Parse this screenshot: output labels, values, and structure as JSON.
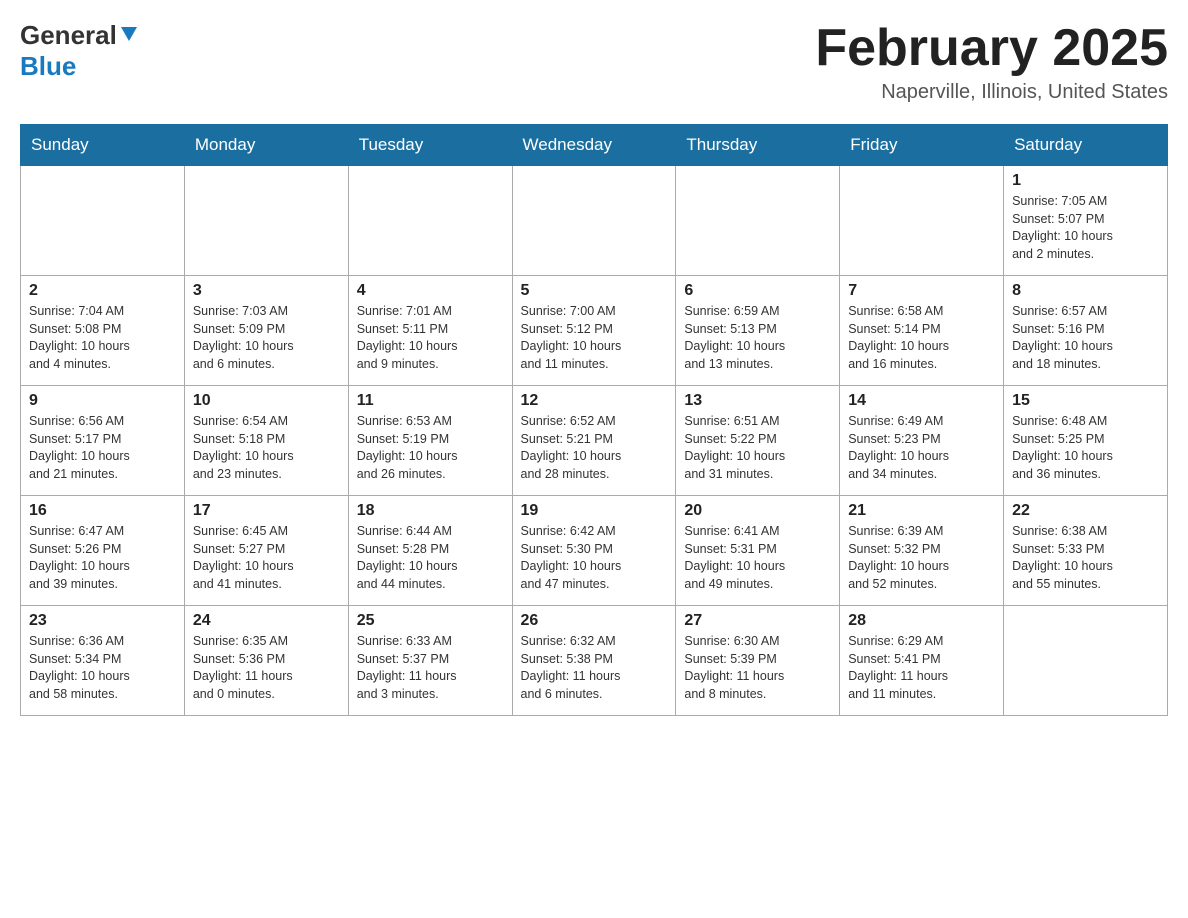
{
  "header": {
    "logo_general": "General",
    "logo_blue": "Blue",
    "month_title": "February 2025",
    "location": "Naperville, Illinois, United States"
  },
  "days_of_week": [
    "Sunday",
    "Monday",
    "Tuesday",
    "Wednesday",
    "Thursday",
    "Friday",
    "Saturday"
  ],
  "weeks": [
    [
      {
        "day": "",
        "info": ""
      },
      {
        "day": "",
        "info": ""
      },
      {
        "day": "",
        "info": ""
      },
      {
        "day": "",
        "info": ""
      },
      {
        "day": "",
        "info": ""
      },
      {
        "day": "",
        "info": ""
      },
      {
        "day": "1",
        "info": "Sunrise: 7:05 AM\nSunset: 5:07 PM\nDaylight: 10 hours\nand 2 minutes."
      }
    ],
    [
      {
        "day": "2",
        "info": "Sunrise: 7:04 AM\nSunset: 5:08 PM\nDaylight: 10 hours\nand 4 minutes."
      },
      {
        "day": "3",
        "info": "Sunrise: 7:03 AM\nSunset: 5:09 PM\nDaylight: 10 hours\nand 6 minutes."
      },
      {
        "day": "4",
        "info": "Sunrise: 7:01 AM\nSunset: 5:11 PM\nDaylight: 10 hours\nand 9 minutes."
      },
      {
        "day": "5",
        "info": "Sunrise: 7:00 AM\nSunset: 5:12 PM\nDaylight: 10 hours\nand 11 minutes."
      },
      {
        "day": "6",
        "info": "Sunrise: 6:59 AM\nSunset: 5:13 PM\nDaylight: 10 hours\nand 13 minutes."
      },
      {
        "day": "7",
        "info": "Sunrise: 6:58 AM\nSunset: 5:14 PM\nDaylight: 10 hours\nand 16 minutes."
      },
      {
        "day": "8",
        "info": "Sunrise: 6:57 AM\nSunset: 5:16 PM\nDaylight: 10 hours\nand 18 minutes."
      }
    ],
    [
      {
        "day": "9",
        "info": "Sunrise: 6:56 AM\nSunset: 5:17 PM\nDaylight: 10 hours\nand 21 minutes."
      },
      {
        "day": "10",
        "info": "Sunrise: 6:54 AM\nSunset: 5:18 PM\nDaylight: 10 hours\nand 23 minutes."
      },
      {
        "day": "11",
        "info": "Sunrise: 6:53 AM\nSunset: 5:19 PM\nDaylight: 10 hours\nand 26 minutes."
      },
      {
        "day": "12",
        "info": "Sunrise: 6:52 AM\nSunset: 5:21 PM\nDaylight: 10 hours\nand 28 minutes."
      },
      {
        "day": "13",
        "info": "Sunrise: 6:51 AM\nSunset: 5:22 PM\nDaylight: 10 hours\nand 31 minutes."
      },
      {
        "day": "14",
        "info": "Sunrise: 6:49 AM\nSunset: 5:23 PM\nDaylight: 10 hours\nand 34 minutes."
      },
      {
        "day": "15",
        "info": "Sunrise: 6:48 AM\nSunset: 5:25 PM\nDaylight: 10 hours\nand 36 minutes."
      }
    ],
    [
      {
        "day": "16",
        "info": "Sunrise: 6:47 AM\nSunset: 5:26 PM\nDaylight: 10 hours\nand 39 minutes."
      },
      {
        "day": "17",
        "info": "Sunrise: 6:45 AM\nSunset: 5:27 PM\nDaylight: 10 hours\nand 41 minutes."
      },
      {
        "day": "18",
        "info": "Sunrise: 6:44 AM\nSunset: 5:28 PM\nDaylight: 10 hours\nand 44 minutes."
      },
      {
        "day": "19",
        "info": "Sunrise: 6:42 AM\nSunset: 5:30 PM\nDaylight: 10 hours\nand 47 minutes."
      },
      {
        "day": "20",
        "info": "Sunrise: 6:41 AM\nSunset: 5:31 PM\nDaylight: 10 hours\nand 49 minutes."
      },
      {
        "day": "21",
        "info": "Sunrise: 6:39 AM\nSunset: 5:32 PM\nDaylight: 10 hours\nand 52 minutes."
      },
      {
        "day": "22",
        "info": "Sunrise: 6:38 AM\nSunset: 5:33 PM\nDaylight: 10 hours\nand 55 minutes."
      }
    ],
    [
      {
        "day": "23",
        "info": "Sunrise: 6:36 AM\nSunset: 5:34 PM\nDaylight: 10 hours\nand 58 minutes."
      },
      {
        "day": "24",
        "info": "Sunrise: 6:35 AM\nSunset: 5:36 PM\nDaylight: 11 hours\nand 0 minutes."
      },
      {
        "day": "25",
        "info": "Sunrise: 6:33 AM\nSunset: 5:37 PM\nDaylight: 11 hours\nand 3 minutes."
      },
      {
        "day": "26",
        "info": "Sunrise: 6:32 AM\nSunset: 5:38 PM\nDaylight: 11 hours\nand 6 minutes."
      },
      {
        "day": "27",
        "info": "Sunrise: 6:30 AM\nSunset: 5:39 PM\nDaylight: 11 hours\nand 8 minutes."
      },
      {
        "day": "28",
        "info": "Sunrise: 6:29 AM\nSunset: 5:41 PM\nDaylight: 11 hours\nand 11 minutes."
      },
      {
        "day": "",
        "info": ""
      }
    ]
  ]
}
